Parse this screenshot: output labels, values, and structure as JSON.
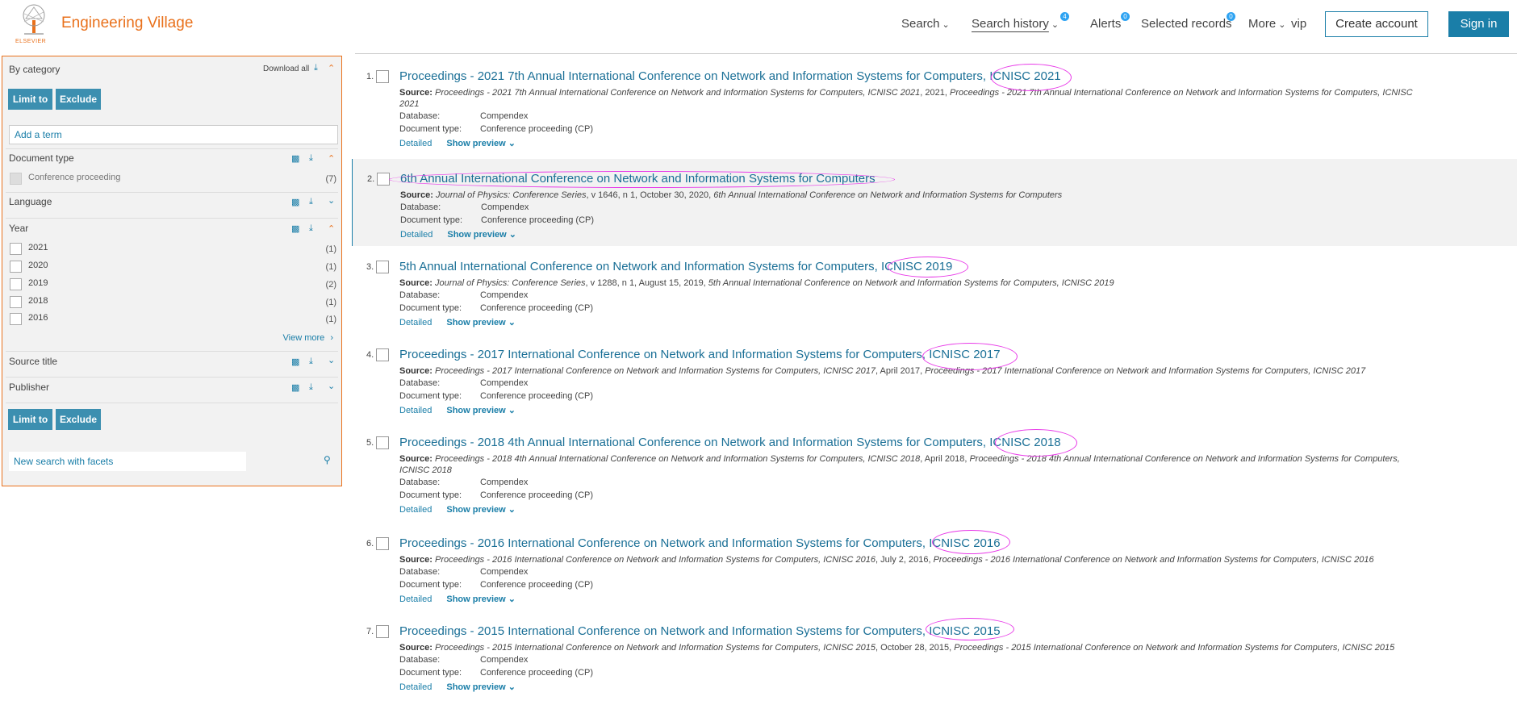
{
  "header": {
    "brand": "Engineering Village",
    "publisher": "ELSEVIER",
    "nav": {
      "search": "Search",
      "search_history": "Search history",
      "search_history_badge": "4",
      "alerts": "Alerts",
      "alerts_badge": "0",
      "selected_records": "Selected records",
      "selected_badge": "0",
      "more": "More",
      "vip": "vip"
    },
    "create_account": "Create account",
    "sign_in": "Sign in"
  },
  "sidebar": {
    "by_category": "By category",
    "download_all": "Download all",
    "limit_to": "Limit to",
    "exclude": "Exclude",
    "add_term_placeholder": "Add a term",
    "document_type": {
      "label": "Document type",
      "items": [
        {
          "label": "Conference proceeding",
          "count": "(7)"
        }
      ]
    },
    "language": {
      "label": "Language"
    },
    "year": {
      "label": "Year",
      "items": [
        {
          "label": "2021",
          "count": "(1)"
        },
        {
          "label": "2020",
          "count": "(1)"
        },
        {
          "label": "2019",
          "count": "(2)"
        },
        {
          "label": "2018",
          "count": "(1)"
        },
        {
          "label": "2016",
          "count": "(1)"
        }
      ],
      "view_more": "View more"
    },
    "source_title": {
      "label": "Source title"
    },
    "publisher": {
      "label": "Publisher"
    },
    "new_search": "New search with facets"
  },
  "results": [
    {
      "num": "1.",
      "title_a": "Proceedings - 2021 7th Annual International Conference on Network and Information Systems for Computers,",
      "title_b": "ICNISC 2021",
      "source_label": "Source:",
      "source_italic": "Proceedings - 2021 7th Annual International Conference on Network and Information Systems for Computers, ICNISC 2021",
      "source_plain": ", 2021, ",
      "source_italic2": "Proceedings - 2021 7th Annual International Conference on Network and Information Systems for Computers, ICNISC 2021",
      "database_label": "Database:",
      "database": "Compendex",
      "doctype_label": "Document type:",
      "doctype": "Conference proceeding (CP)",
      "detailed": "Detailed",
      "show_preview": "Show preview"
    },
    {
      "num": "2.",
      "title_a": "",
      "title_b": "6th Annual International Conference on Network and Information Systems for Computers",
      "source_label": "Source:",
      "source_italic": "Journal of Physics: Conference Series",
      "source_plain": ", v 1646, n 1, October 30, 2020, ",
      "source_italic2": "6th Annual International Conference on Network and Information Systems for Computers",
      "database_label": "Database:",
      "database": "Compendex",
      "doctype_label": "Document type:",
      "doctype": "Conference proceeding (CP)",
      "detailed": "Detailed",
      "show_preview": "Show preview"
    },
    {
      "num": "3.",
      "title_a": "5th Annual International Conference on Network and Information Systems for Computers,",
      "title_b": "ICNISC 2019",
      "source_label": "Source:",
      "source_italic": "Journal of Physics: Conference Series",
      "source_plain": ", v 1288, n 1, August 15, 2019, ",
      "source_italic2": "5th Annual International Conference on Network and Information Systems for Computers, ICNISC 2019",
      "database_label": "Database:",
      "database": "Compendex",
      "doctype_label": "Document type:",
      "doctype": "Conference proceeding (CP)",
      "detailed": "Detailed",
      "show_preview": "Show preview"
    },
    {
      "num": "4.",
      "title_a": "Proceedings - 2017 International Conference on Network and Information Systems for Computers,",
      "title_b": "ICNISC 2017",
      "source_label": "Source:",
      "source_italic": "Proceedings - 2017 International Conference on Network and Information Systems for Computers, ICNISC 2017",
      "source_plain": ", April 2017, ",
      "source_italic2": "Proceedings - 2017 International Conference on Network and Information Systems for Computers, ICNISC 2017",
      "database_label": "Database:",
      "database": "Compendex",
      "doctype_label": "Document type:",
      "doctype": "Conference proceeding (CP)",
      "detailed": "Detailed",
      "show_preview": "Show preview"
    },
    {
      "num": "5.",
      "title_a": "Proceedings - 2018 4th Annual International Conference on Network and Information Systems for Computers,",
      "title_b": "ICNISC 2018",
      "source_label": "Source:",
      "source_italic": "Proceedings - 2018 4th Annual International Conference on Network and Information Systems for Computers, ICNISC 2018",
      "source_plain": ", April 2018, ",
      "source_italic2": "Proceedings - 2018 4th Annual International Conference on Network and Information Systems for Computers, ICNISC 2018",
      "database_label": "Database:",
      "database": "Compendex",
      "doctype_label": "Document type:",
      "doctype": "Conference proceeding (CP)",
      "detailed": "Detailed",
      "show_preview": "Show preview"
    },
    {
      "num": "6.",
      "title_a": "Proceedings - 2016 International Conference on Network and Information Systems for Computers,",
      "title_b": "ICNISC 2016",
      "source_label": "Source:",
      "source_italic": "Proceedings - 2016 International Conference on Network and Information Systems for Computers, ICNISC 2016",
      "source_plain": ", July 2, 2016, ",
      "source_italic2": "Proceedings - 2016 International Conference on Network and Information Systems for Computers, ICNISC 2016",
      "database_label": "Database:",
      "database": "Compendex",
      "doctype_label": "Document type:",
      "doctype": "Conference proceeding (CP)",
      "detailed": "Detailed",
      "show_preview": "Show preview"
    },
    {
      "num": "7.",
      "title_a": "Proceedings - 2015 International Conference on Network and Information Systems for Computers,",
      "title_b": "ICNISC 2015",
      "source_label": "Source:",
      "source_italic": "Proceedings - 2015 International Conference on Network and Information Systems for Computers, ICNISC 2015",
      "source_plain": ", October 28, 2015, ",
      "source_italic2": "Proceedings - 2015 International Conference on Network and Information Systems for Computers, ICNISC 2015",
      "database_label": "Database:",
      "database": "Compendex",
      "doctype_label": "Document type:",
      "doctype": "Conference proceeding (CP)",
      "detailed": "Detailed",
      "show_preview": "Show preview"
    }
  ],
  "colors": {
    "brand_orange": "#e9711c",
    "link_blue": "#1a7ea8",
    "button_blue": "#3c8fb0",
    "annotation_magenta": "#e83ae8"
  }
}
